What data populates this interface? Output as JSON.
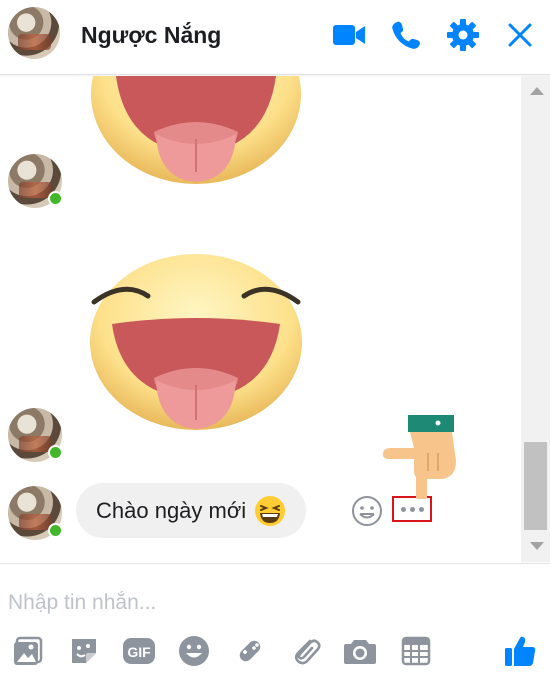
{
  "header": {
    "contact_name": "Ngược Nắng",
    "icons": [
      "video-call-icon",
      "phone-call-icon",
      "settings-gear-icon",
      "close-icon"
    ]
  },
  "conversation": {
    "stickers": [
      "tongue-out-emoji-sticker",
      "tongue-out-emoji-sticker"
    ],
    "message": {
      "text": "Chào ngày mới",
      "emoji": "grinning-squinting-face"
    },
    "message_actions": [
      "react-emoji-icon",
      "more-options-icon"
    ]
  },
  "composer": {
    "placeholder": "Nhập tin nhắn...",
    "tools": [
      "add-photos-icon",
      "sticker-icon",
      "gif-icon",
      "emoji-icon",
      "games-icon",
      "attach-file-icon",
      "camera-icon",
      "calendar-icon"
    ],
    "send_icon": "thumbs-up-icon"
  },
  "colors": {
    "accent": "#0084ff",
    "online": "#42b72a",
    "bubble": "#f1f0f0",
    "highlight": "#d9141a"
  }
}
